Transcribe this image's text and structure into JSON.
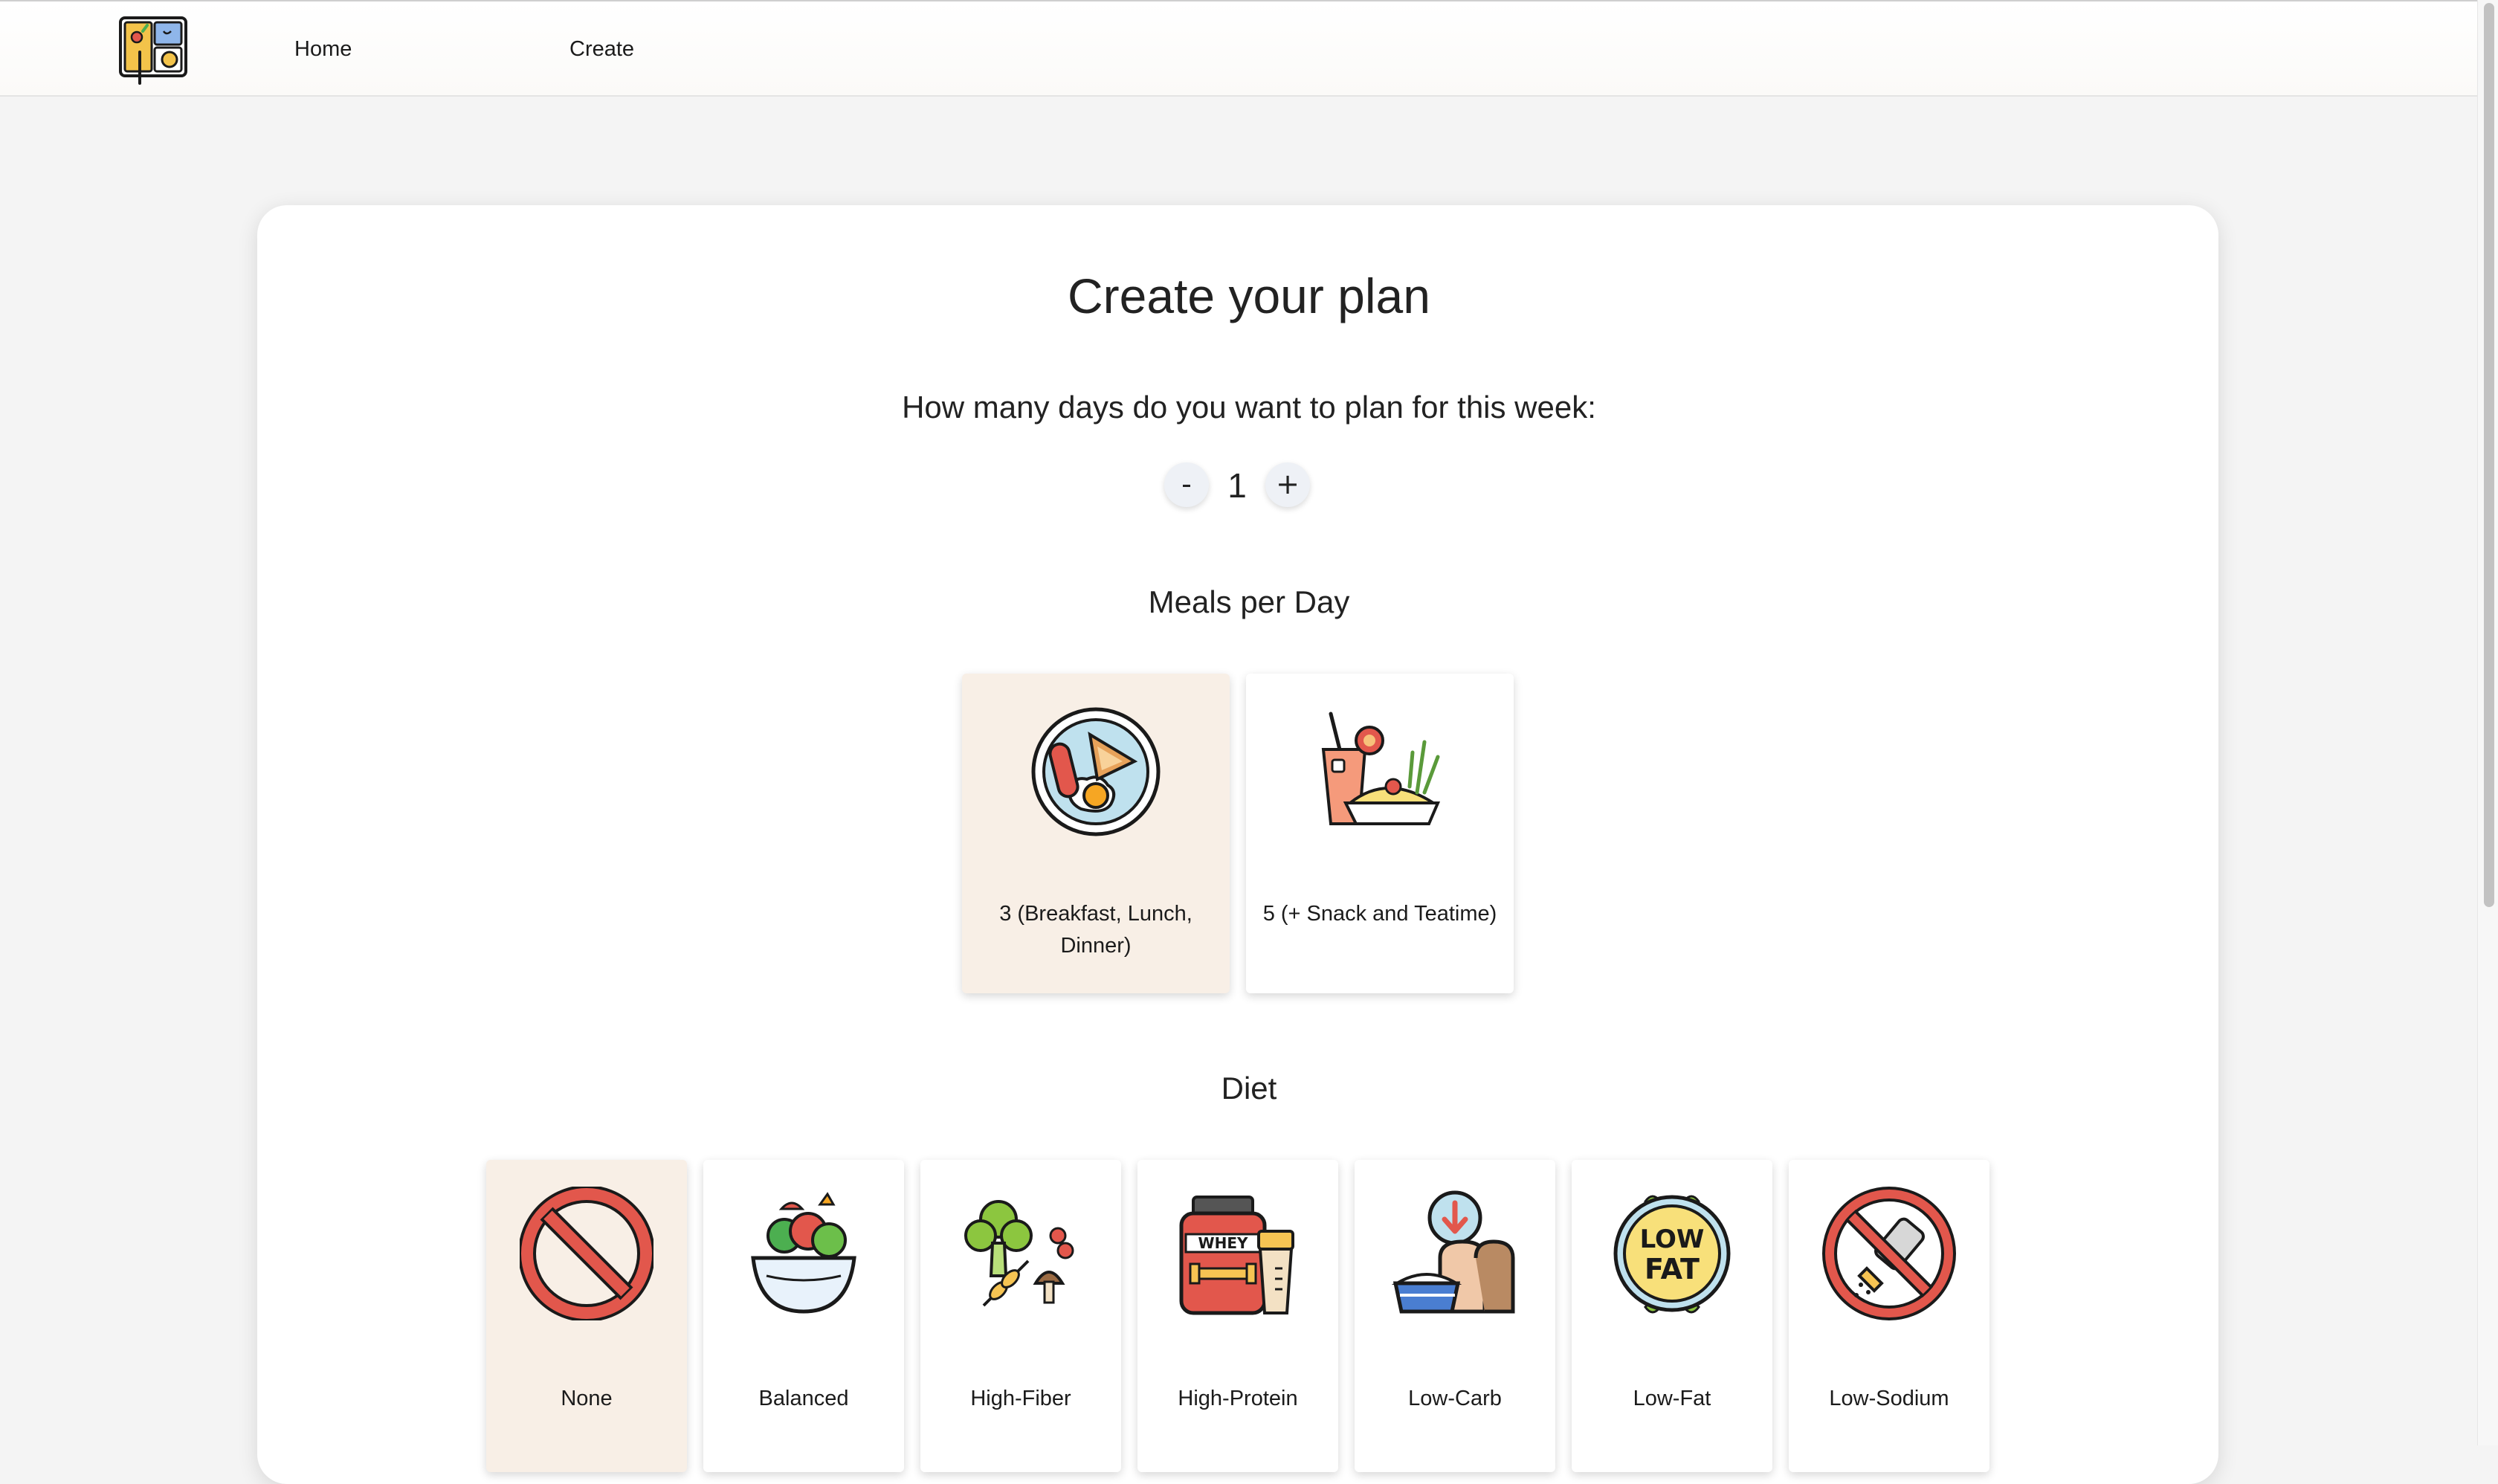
{
  "nav": {
    "home_label": "Home",
    "create_label": "Create"
  },
  "page": {
    "title": "Create your plan",
    "days_question": "How many days do you want to plan for this week:",
    "days_minus": "-",
    "days_value": "1",
    "days_plus": "+"
  },
  "meals": {
    "heading": "Meals per Day",
    "options": [
      {
        "label": "3 (Breakfast, Lunch, Dinner)",
        "icon": "breakfast-plate-icon",
        "selected": true
      },
      {
        "label": "5 (+ Snack and Teatime)",
        "icon": "drink-and-meal-icon",
        "selected": false
      }
    ]
  },
  "diet": {
    "heading": "Diet",
    "options": [
      {
        "label": "None",
        "icon": "prohibited-icon",
        "selected": true
      },
      {
        "label": "Balanced",
        "icon": "salad-bowl-icon",
        "selected": false
      },
      {
        "label": "High-Fiber",
        "icon": "broccoli-wheat-icon",
        "selected": false
      },
      {
        "label": "High-Protein",
        "icon": "whey-protein-icon",
        "selected": false
      },
      {
        "label": "Low-Carb",
        "icon": "bread-rice-down-icon",
        "selected": false
      },
      {
        "label": "Low-Fat",
        "icon": "low-fat-badge-icon",
        "selected": false
      },
      {
        "label": "Low-Sodium",
        "icon": "no-salt-icon",
        "selected": false
      }
    ]
  },
  "colors": {
    "page_background": "#f4f4f4",
    "card_background": "#ffffff",
    "selected_background": "#f8efe6",
    "stepper_button": "#eef1f6"
  }
}
